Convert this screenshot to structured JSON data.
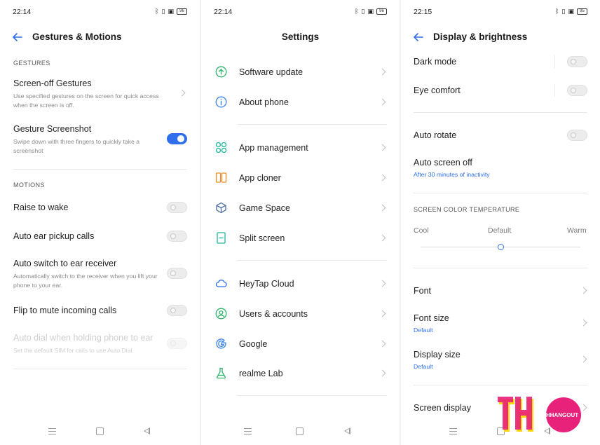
{
  "panel1": {
    "status": {
      "time": "22:14",
      "battery": "96"
    },
    "title": "Gestures & Motions",
    "section_gestures": "GESTURES",
    "screen_off": {
      "title": "Screen-off Gestures",
      "sub": "Use specified gestures on the screen for quick access when the screen is off."
    },
    "gesture_screenshot": {
      "title": "Gesture Screenshot",
      "sub": "Swipe down with three fingers to quickly take a screenshot",
      "enabled": true
    },
    "section_motions": "MOTIONS",
    "raise_to_wake": "Raise to wake",
    "auto_ear_pickup": "Auto ear pickup calls",
    "auto_switch": {
      "title": "Auto switch to ear receiver",
      "sub": "Automatically switch to the receiver when you lift your phone to your ear."
    },
    "flip_to_mute": "Flip to mute incoming calls",
    "auto_dial": {
      "title": "Auto dial when holding phone to ear",
      "sub": "Set the default SIM for calls to use Auto Dial."
    }
  },
  "panel2": {
    "status": {
      "time": "22:14",
      "battery": "96"
    },
    "title": "Settings",
    "items": [
      {
        "label": "Software update",
        "icon": "software-update-icon",
        "color": "#2fb36a"
      },
      {
        "label": "About phone",
        "icon": "info-icon",
        "color": "#3b82e6"
      },
      {
        "label": "App management",
        "icon": "app-management-icon",
        "color": "#1fb89c"
      },
      {
        "label": "App cloner",
        "icon": "app-cloner-icon",
        "color": "#f08a24"
      },
      {
        "label": "Game Space",
        "icon": "game-space-icon",
        "color": "#4a6c9e"
      },
      {
        "label": "Split screen",
        "icon": "split-screen-icon",
        "color": "#1fb89c"
      },
      {
        "label": "HeyTap Cloud",
        "icon": "cloud-icon",
        "color": "#2f6fec"
      },
      {
        "label": "Users & accounts",
        "icon": "user-icon",
        "color": "#2fb36a"
      },
      {
        "label": "Google",
        "icon": "google-icon",
        "color": "#3b82e6"
      },
      {
        "label": "realme Lab",
        "icon": "lab-flask-icon",
        "color": "#2fb36a"
      }
    ]
  },
  "panel3": {
    "status": {
      "time": "22:15",
      "battery": "95"
    },
    "title": "Display & brightness",
    "dark_mode": "Dark mode",
    "eye_comfort": "Eye comfort",
    "auto_rotate": "Auto rotate",
    "auto_screen_off": {
      "title": "Auto screen off",
      "sub": "After 30 minutes of inactivity"
    },
    "section_color_temp": "SCREEN COLOR TEMPERATURE",
    "temp_labels": {
      "cool": "Cool",
      "default": "Default",
      "warm": "Warm"
    },
    "temp_value": 0.5,
    "font": "Font",
    "font_size": {
      "title": "Font size",
      "sub": "Default"
    },
    "display_size": {
      "title": "Display size",
      "sub": "Default"
    },
    "screen_display": "Screen display"
  },
  "watermark": {
    "letters": "THO",
    "text": "TECHHANGOUT",
    "color": "#e8217a",
    "accent": "#ffd400"
  },
  "colors": {
    "accent": "#2f6fec",
    "text": "#1f1f1f",
    "muted": "#8a8a8a"
  }
}
